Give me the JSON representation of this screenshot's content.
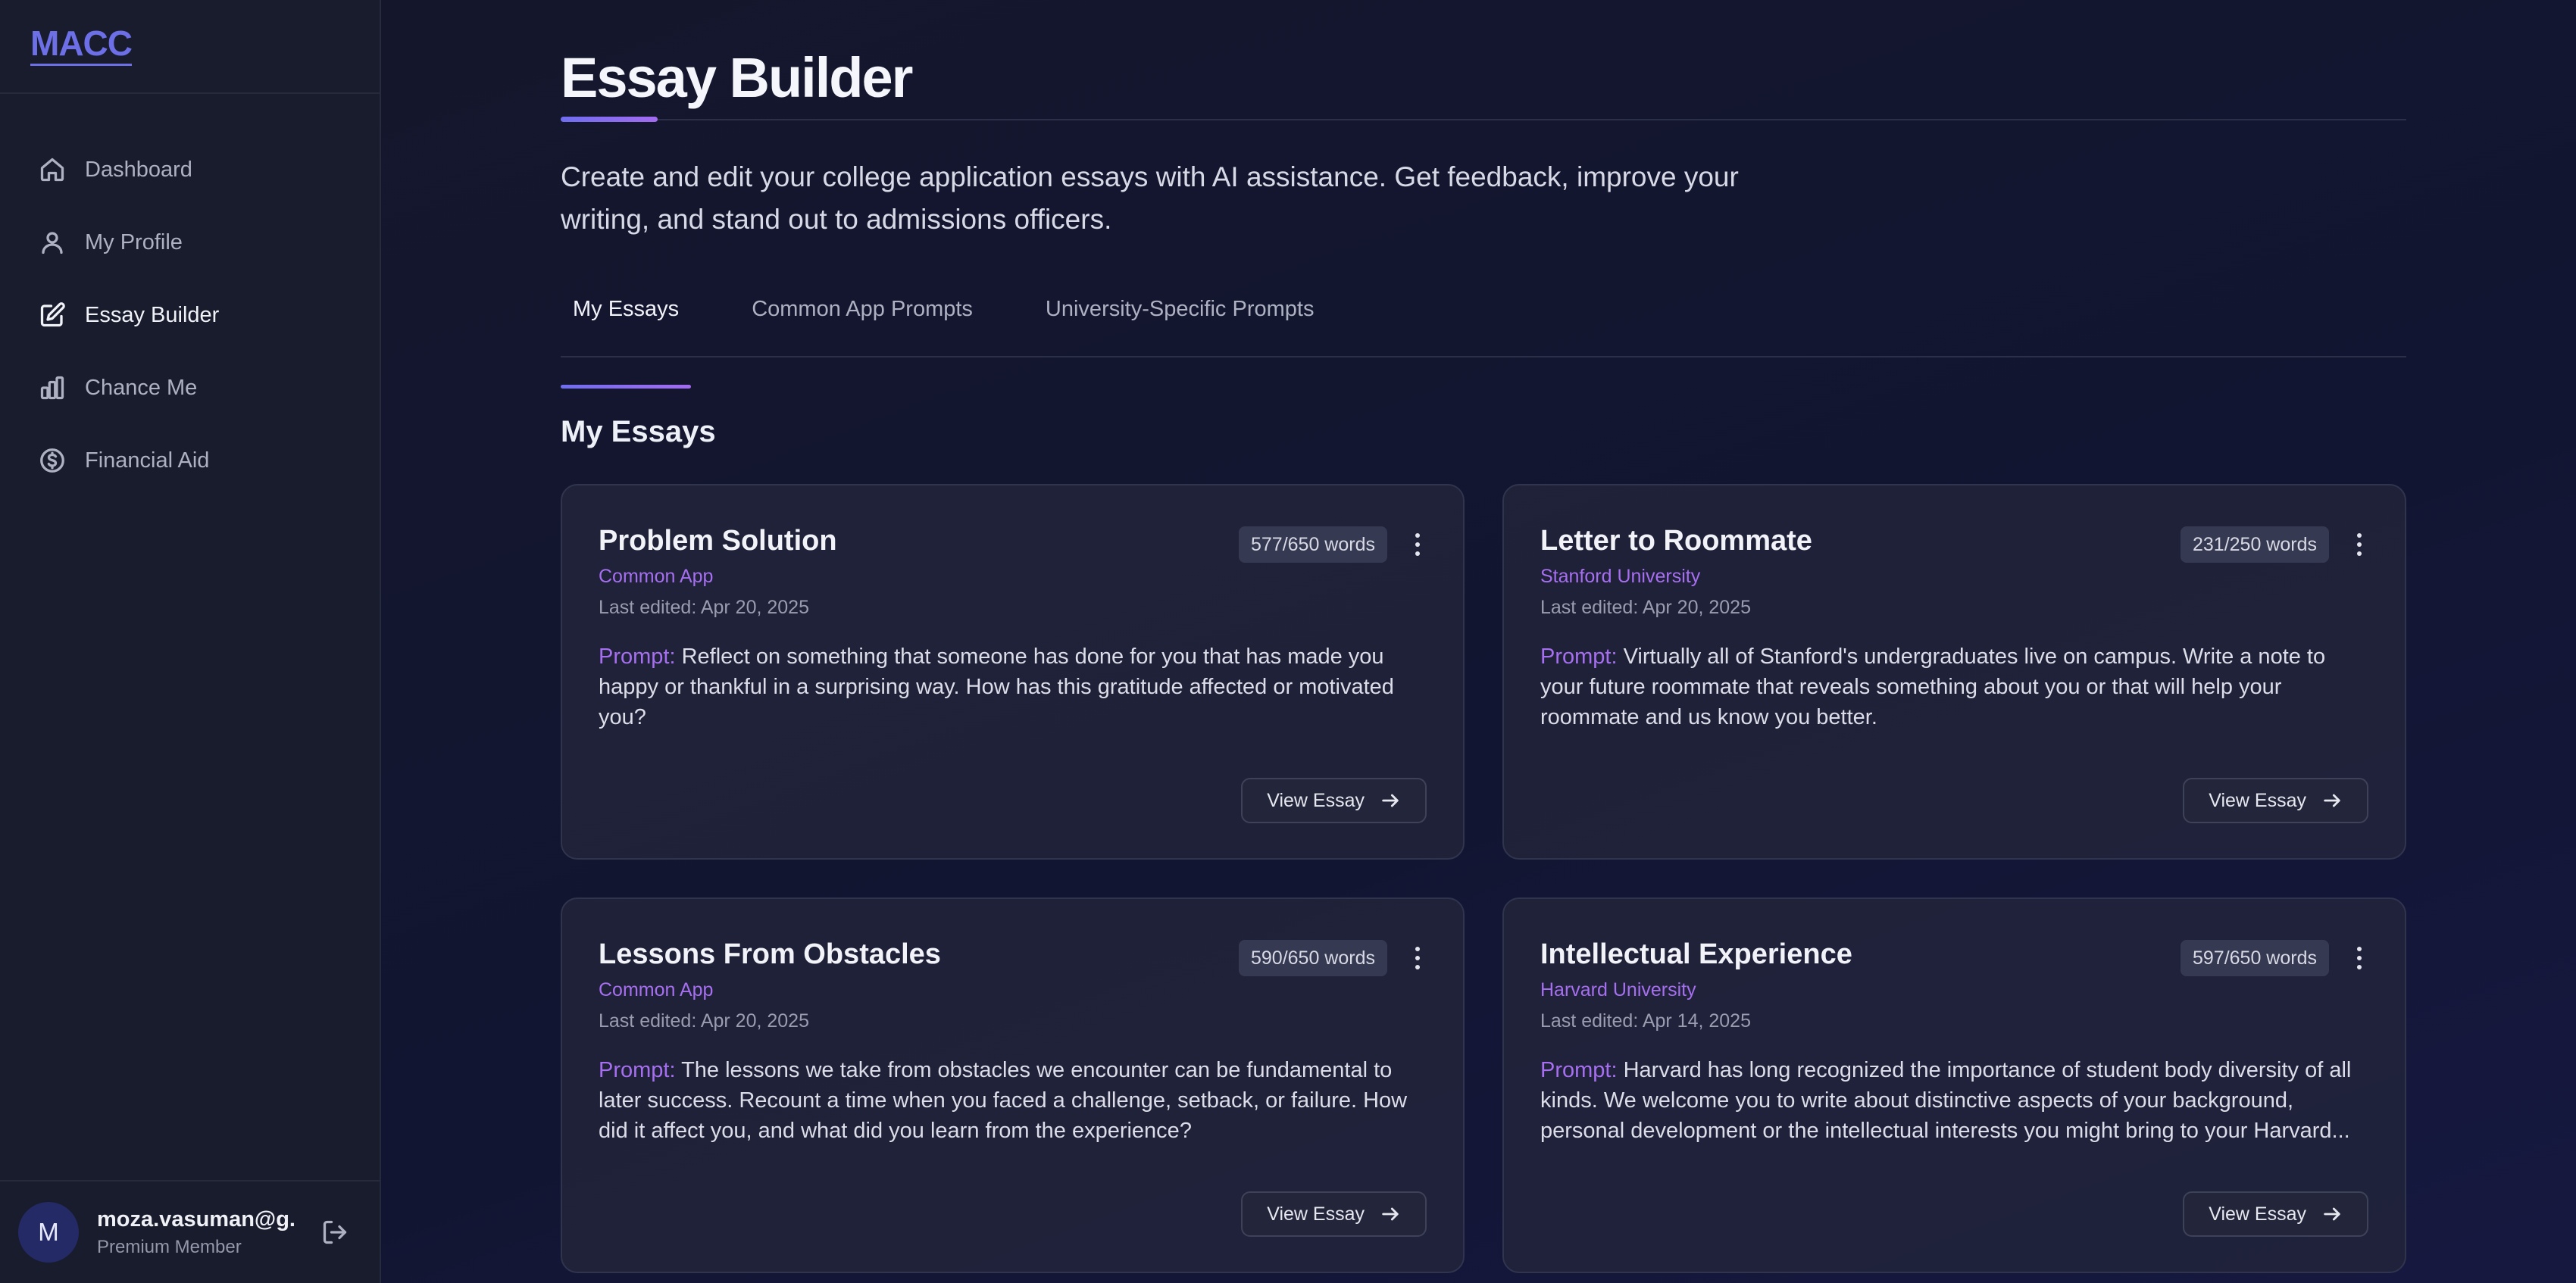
{
  "brand": {
    "logo": "MACC"
  },
  "sidebar": {
    "items": [
      {
        "label": "Dashboard",
        "icon": "home-icon",
        "active": false
      },
      {
        "label": "My Profile",
        "icon": "user-icon",
        "active": false
      },
      {
        "label": "Essay Builder",
        "icon": "edit-icon",
        "active": true
      },
      {
        "label": "Chance Me",
        "icon": "bar-chart-icon",
        "active": false
      },
      {
        "label": "Financial Aid",
        "icon": "dollar-circle-icon",
        "active": false
      }
    ]
  },
  "user": {
    "initial": "M",
    "email": "moza.vasuman@g...",
    "role": "Premium Member"
  },
  "page": {
    "title": "Essay Builder",
    "description": "Create and edit your college application essays with AI assistance. Get feedback, improve your writing, and stand out to admissions officers."
  },
  "tabs": [
    {
      "label": "My Essays",
      "active": true
    },
    {
      "label": "Common App Prompts",
      "active": false
    },
    {
      "label": "University-Specific Prompts",
      "active": false
    }
  ],
  "section": {
    "title": "My Essays"
  },
  "essays": [
    {
      "title": "Problem Solution",
      "words": "577/650 words",
      "source": "Common App",
      "edited": "Last edited: Apr 20, 2025",
      "prompt_label": "Prompt:",
      "prompt": "Reflect on something that someone has done for you that has made you happy or thankful in a surprising way. How has this gratitude affected or motivated you?",
      "button": "View Essay"
    },
    {
      "title": "Letter to Roommate",
      "words": "231/250 words",
      "source": "Stanford University",
      "edited": "Last edited: Apr 20, 2025",
      "prompt_label": "Prompt:",
      "prompt": "Virtually all of Stanford's undergraduates live on campus. Write a note to your future roommate that reveals something about you or that will help your roommate and us know you better.",
      "button": "View Essay"
    },
    {
      "title": "Lessons From Obstacles",
      "words": "590/650 words",
      "source": "Common App",
      "edited": "Last edited: Apr 20, 2025",
      "prompt_label": "Prompt:",
      "prompt": "The lessons we take from obstacles we encounter can be fundamental to later success. Recount a time when you faced a challenge, setback, or failure. How did it affect you, and what did you learn from the experience?",
      "button": "View Essay"
    },
    {
      "title": "Intellectual Experience",
      "words": "597/650 words",
      "source": "Harvard University",
      "edited": "Last edited: Apr 14, 2025",
      "prompt_label": "Prompt:",
      "prompt": "Harvard has long recognized the importance of student body diversity of all kinds. We welcome you to write about distinctive aspects of your background, personal development or the intellectual interests you might bring to your Harvard...",
      "button": "View Essay"
    }
  ],
  "colors": {
    "accent": "#6c6fe6",
    "accent_purple": "#a66ff0",
    "background": "#11142a",
    "card": "#22253a"
  }
}
